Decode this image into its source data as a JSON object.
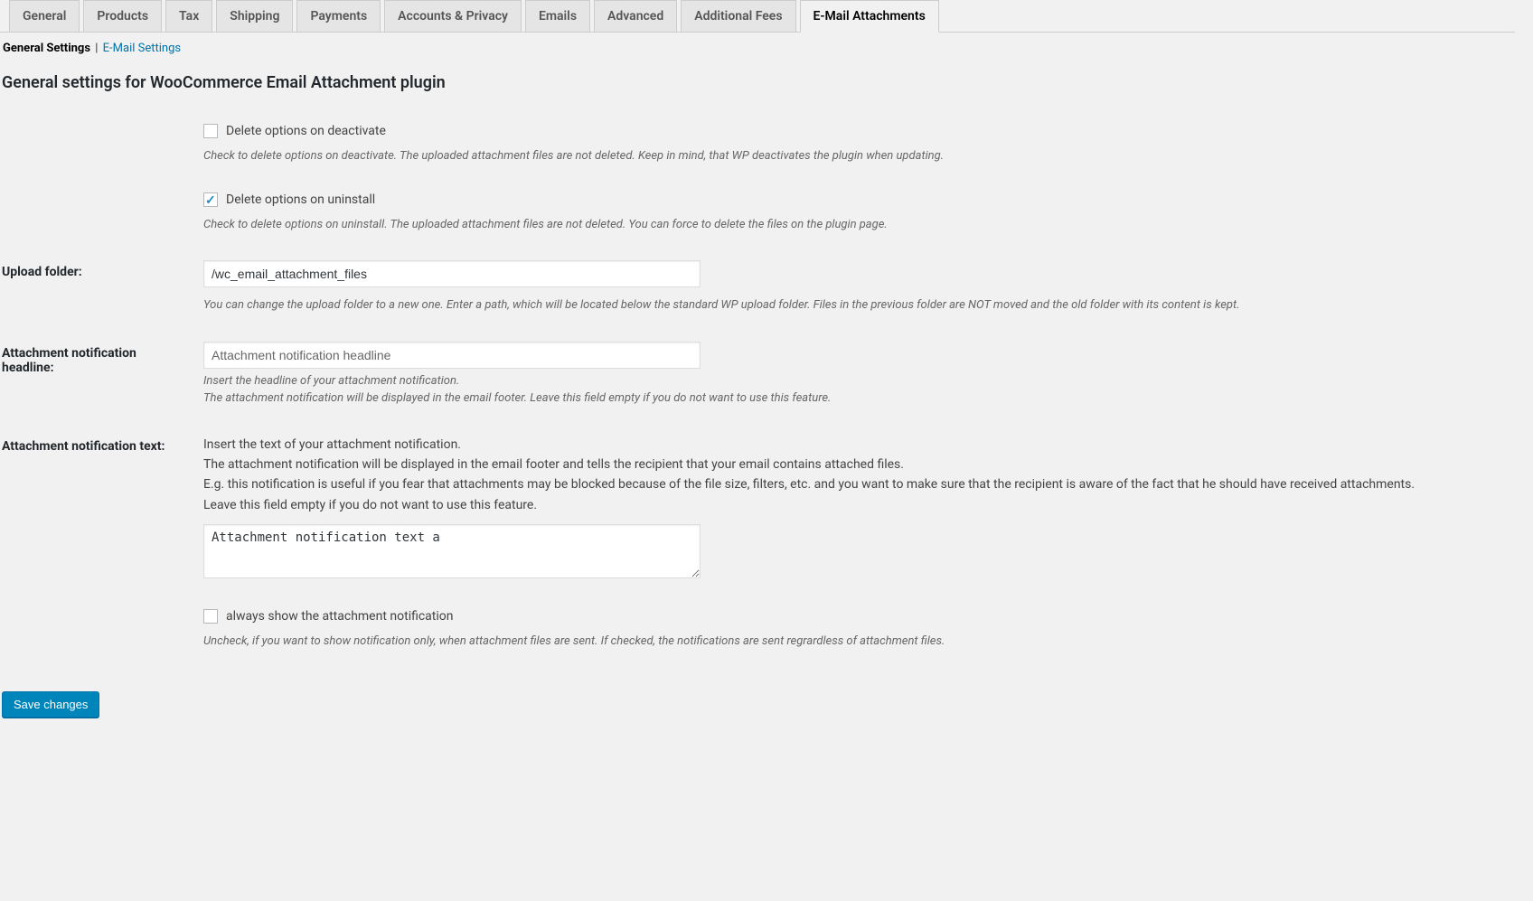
{
  "tabs": [
    {
      "label": "General"
    },
    {
      "label": "Products"
    },
    {
      "label": "Tax"
    },
    {
      "label": "Shipping"
    },
    {
      "label": "Payments"
    },
    {
      "label": "Accounts & Privacy"
    },
    {
      "label": "Emails"
    },
    {
      "label": "Advanced"
    },
    {
      "label": "Additional Fees"
    },
    {
      "label": "E-Mail Attachments"
    }
  ],
  "subnav": {
    "current": "General Settings",
    "link": "E-Mail Settings"
  },
  "section_title": "General settings for WooCommerce Email Attachment plugin",
  "fields": {
    "delete_deactivate": {
      "label": "Delete options on deactivate",
      "description": "Check to delete options on deactivate. The uploaded attachment files are not deleted. Keep in mind, that WP deactivates the plugin when updating."
    },
    "delete_uninstall": {
      "label": "Delete options on uninstall",
      "description": "Check to delete options on uninstall. The uploaded attachment files are not deleted. You can force to delete the files on the plugin page."
    },
    "upload_folder": {
      "th": "Upload folder:",
      "value": "/wc_email_attachment_files",
      "description": "You can change the upload folder to a new one. Enter a path, which will be located below the standard WP upload folder. Files in the previous folder are NOT moved and the old folder with its content is kept."
    },
    "headline": {
      "th": "Attachment notification headline:",
      "placeholder": "Attachment notification headline",
      "description1": "Insert the headline of your attachment notification.",
      "description2": "The attachment notification will be displayed in the email footer. Leave this field empty if you do not want to use this feature."
    },
    "text": {
      "th": "Attachment notification text:",
      "help1": "Insert the text of your attachment notification.",
      "help2": "The attachment notification will be displayed in the email footer and tells the recipient that your email contains attached files.",
      "help3": "E.g. this notification is useful if you fear that attachments may be blocked because of the file size, filters, etc. and you want to make sure that the recipient is aware of the fact that he should have received attachments.",
      "help4": "Leave this field empty if you do not want to use this feature.",
      "value": "Attachment notification text a"
    },
    "always_show": {
      "label": "always show the attachment notification",
      "description": "Uncheck, if you want to show notification only, when attachment files are sent. If checked, the notifications are sent regrardless of attachment files."
    }
  },
  "save_button": "Save changes"
}
